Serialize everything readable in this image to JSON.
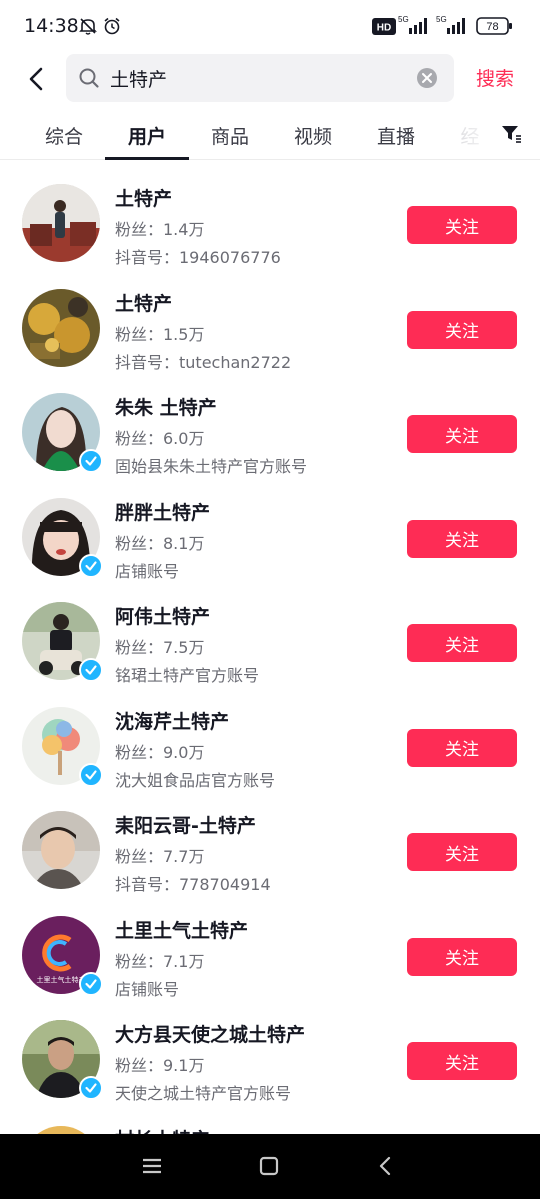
{
  "status_bar": {
    "time": "14:38",
    "battery": "78",
    "network_a": "5G",
    "network_b": "5G",
    "hd_label": "HD"
  },
  "search": {
    "query": "土特产",
    "button_label": "搜索"
  },
  "tabs": [
    "综合",
    "用户",
    "商品",
    "视频",
    "直播",
    "经"
  ],
  "active_tab": "用户",
  "follow_label": "关注",
  "users": [
    {
      "name": "土特产",
      "fans": "粉丝：1.4万",
      "desc": "抖音号：1946076776",
      "verified": false
    },
    {
      "name": "土特产",
      "fans": "粉丝：1.5万",
      "desc": "抖音号：tutechan2722",
      "verified": false
    },
    {
      "name": "朱朱 土特产",
      "fans": "粉丝：6.0万",
      "desc": "固始县朱朱土特产官方账号",
      "verified": true
    },
    {
      "name": "胖胖土特产",
      "fans": "粉丝：8.1万",
      "desc": "店铺账号",
      "verified": true
    },
    {
      "name": "阿伟土特产",
      "fans": "粉丝：7.5万",
      "desc": "铭珺土特产官方账号",
      "verified": true
    },
    {
      "name": "沈海芹土特产",
      "fans": "粉丝：9.0万",
      "desc": "沈大姐食品店官方账号",
      "verified": true
    },
    {
      "name": "耒阳云哥-土特产",
      "fans": "粉丝：7.7万",
      "desc": "抖音号：778704914",
      "verified": false
    },
    {
      "name": "土里土气土特产",
      "fans": "粉丝：7.1万",
      "desc": "店铺账号",
      "verified": true
    },
    {
      "name": "大方县天使之城土特产",
      "fans": "粉丝：9.1万",
      "desc": "天使之城土特产官方账号",
      "verified": true
    }
  ],
  "partial_user": {
    "name": "村长土特产"
  },
  "avatar_logo_text": "土里土气土特产",
  "colors": {
    "accent": "#fe2c55",
    "verified": "#20b5ff",
    "text_primary": "#161823",
    "text_secondary": "#6b6c74"
  },
  "icons": [
    "back-arrow-icon",
    "search-icon",
    "clear-icon",
    "filter-icon",
    "menu-icon",
    "home-square-icon",
    "back-nav-icon",
    "verified-check-icon"
  ]
}
